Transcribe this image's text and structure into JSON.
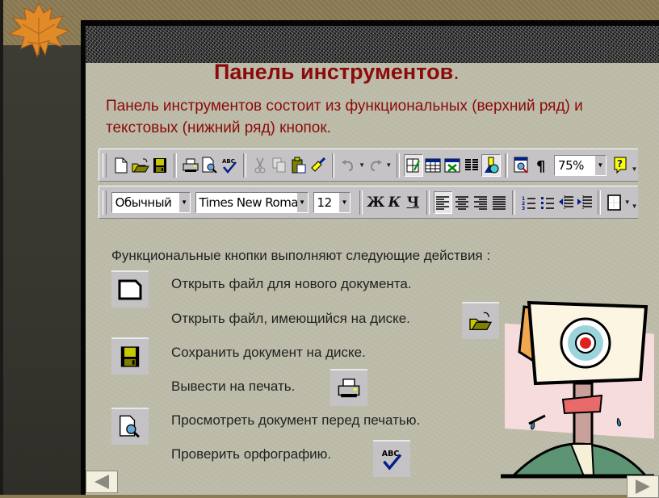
{
  "slide": {
    "title": "Панель инструментов",
    "title_punct": ".",
    "intro": "Панель инструментов состоит из функциональных (верхний ряд) и текстовых (нижний ряд) кнопок."
  },
  "toolbar_standard": {
    "buttons": [
      "new-document",
      "open",
      "save",
      "print",
      "print-preview",
      "spelling",
      "cut",
      "copy",
      "paste",
      "format-painter",
      "undo",
      "redo",
      "tables-and-borders",
      "insert-table",
      "insert-excel-sheet",
      "columns",
      "drawing",
      "document-map",
      "show-formatting",
      "zoom",
      "help"
    ],
    "zoom_value": "75%"
  },
  "toolbar_formatting": {
    "style_value": "Обычный",
    "font_value": "Times New Roman",
    "size_value": "12",
    "bold_label": "Ж",
    "italic_label": "К",
    "underline_label": "Ч",
    "align": [
      "left",
      "center",
      "right",
      "justify"
    ],
    "align_active": "left"
  },
  "functions": {
    "heading": "Функциональные кнопки выполняют следующие действия :",
    "items": [
      {
        "icon": "new-document-icon",
        "text": "Открыть файл для нового документа."
      },
      {
        "icon": "open-folder-icon",
        "text": "Открыть файл, имеющийся на диске."
      },
      {
        "icon": "save-icon",
        "text": "Сохранить документ на диске."
      },
      {
        "icon": "printer-icon",
        "text": "Вывести на печать."
      },
      {
        "icon": "print-preview-icon",
        "text": "Просмотреть документ перед печатью."
      },
      {
        "icon": "spelling-icon",
        "text": "Проверить орфографию."
      }
    ]
  },
  "nav": {
    "prev": "previous-slide",
    "next": "next-slide"
  }
}
